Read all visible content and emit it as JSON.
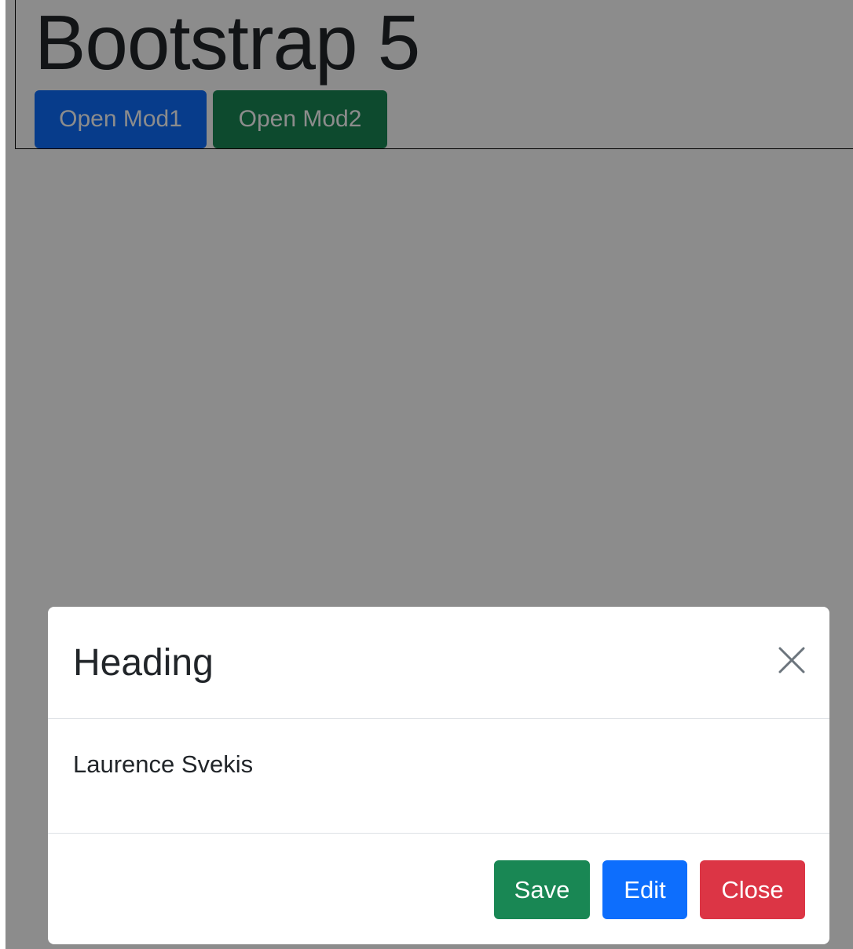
{
  "page": {
    "title": "Bootstrap 5",
    "buttons": {
      "open_mod1": "Open Mod1",
      "open_mod2": "Open Mod2"
    }
  },
  "modal": {
    "title": "Heading",
    "body_text": "Laurence Svekis",
    "close_icon": "close-icon",
    "footer": {
      "save_label": "Save",
      "edit_label": "Edit",
      "close_label": "Close"
    }
  },
  "colors": {
    "primary": "#0d6efd",
    "success": "#198754",
    "danger": "#dc3545",
    "text": "#212529",
    "divider": "#dee2e6"
  }
}
